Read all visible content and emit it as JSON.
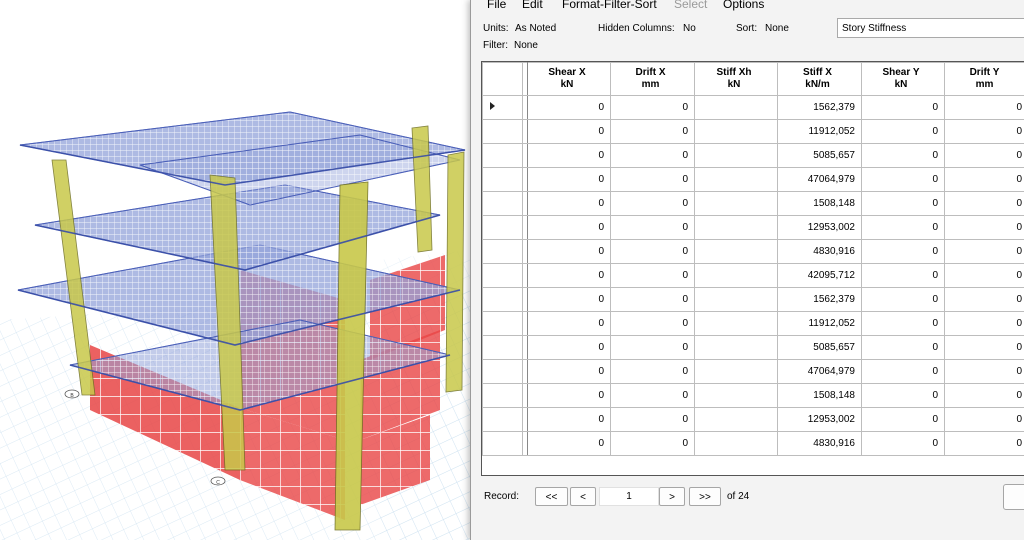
{
  "menu": {
    "file": "File",
    "edit": "Edit",
    "format": "Format-Filter-Sort",
    "select": "Select",
    "options": "Options"
  },
  "info": {
    "units_label": "Units:",
    "units_value": "As Noted",
    "hidden_label": "Hidden Columns:",
    "hidden_value": "No",
    "sort_label": "Sort:",
    "sort_value": "None",
    "filter_label": "Filter:",
    "filter_value": "None"
  },
  "table_name": "Story Stiffness",
  "columns": [
    {
      "name": "Shear X",
      "unit": "kN"
    },
    {
      "name": "Drift X",
      "unit": "mm"
    },
    {
      "name": "Stiff Xh",
      "unit": "kN"
    },
    {
      "name": "Stiff X",
      "unit": "kN/m"
    },
    {
      "name": "Shear Y",
      "unit": "kN"
    },
    {
      "name": "Drift Y",
      "unit": "mm"
    }
  ],
  "rows": [
    [
      "0",
      "0",
      "",
      "1562,379",
      "0",
      "0"
    ],
    [
      "0",
      "0",
      "",
      "11912,052",
      "0",
      "0"
    ],
    [
      "0",
      "0",
      "",
      "5085,657",
      "0",
      "0"
    ],
    [
      "0",
      "0",
      "",
      "47064,979",
      "0",
      "0"
    ],
    [
      "0",
      "0",
      "",
      "1508,148",
      "0",
      "0"
    ],
    [
      "0",
      "0",
      "",
      "12953,002",
      "0",
      "0"
    ],
    [
      "0",
      "0",
      "",
      "4830,916",
      "0",
      "0"
    ],
    [
      "0",
      "0",
      "",
      "42095,712",
      "0",
      "0"
    ],
    [
      "0",
      "0",
      "",
      "1562,379",
      "0",
      "0"
    ],
    [
      "0",
      "0",
      "",
      "11912,052",
      "0",
      "0"
    ],
    [
      "0",
      "0",
      "",
      "5085,657",
      "0",
      "0"
    ],
    [
      "0",
      "0",
      "",
      "47064,979",
      "0",
      "0"
    ],
    [
      "0",
      "0",
      "",
      "1508,148",
      "0",
      "0"
    ],
    [
      "0",
      "0",
      "",
      "12953,002",
      "0",
      "0"
    ],
    [
      "0",
      "0",
      "",
      "4830,916",
      "0",
      "0"
    ]
  ],
  "footer": {
    "record_label": "Record:",
    "first": "<<",
    "prev": "<",
    "current": "1",
    "next": ">",
    "last": ">>",
    "total": "of 24"
  },
  "model_view": {
    "grid_bubbles": [
      "B",
      "C"
    ],
    "slab_color": "#8f9fd8",
    "column_color": "#c7c74a",
    "wall_color": "#e23a3a"
  }
}
